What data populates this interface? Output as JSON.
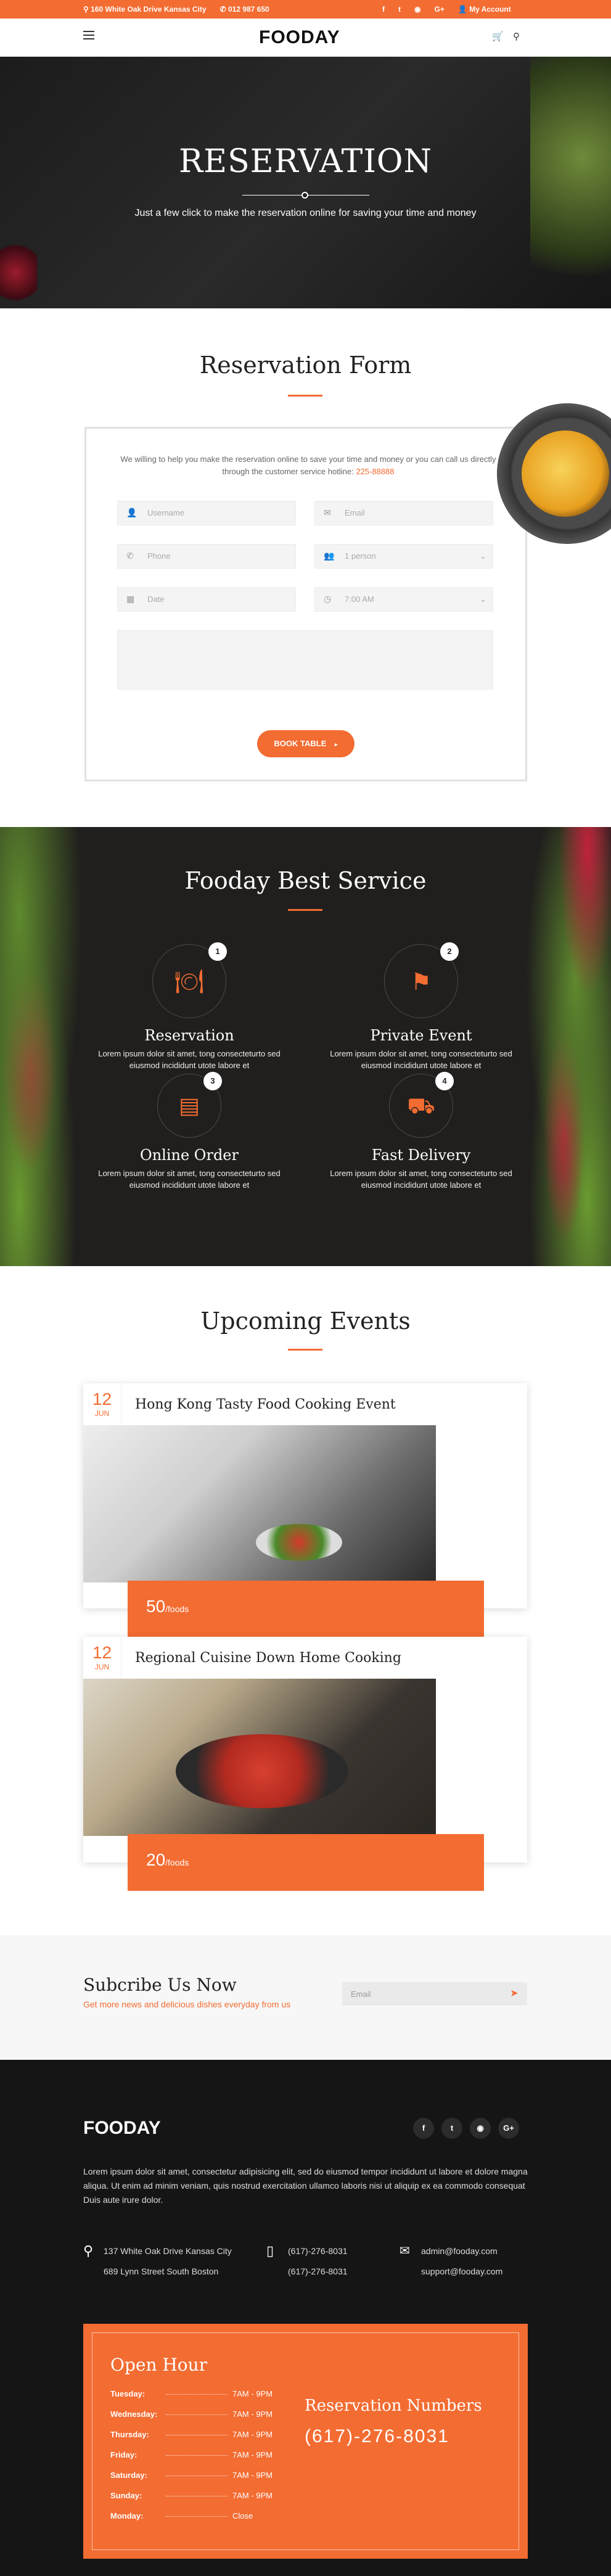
{
  "topbar": {
    "address": "160 White Oak Drive Kansas City",
    "phone": "012 987 650",
    "account": "My Account",
    "socials": [
      "f",
      "t",
      "◉",
      "G+"
    ]
  },
  "header": {
    "logo": "FOODAY"
  },
  "hero": {
    "title": "RESERVATION",
    "subtitle": "Just a few click to make the reservation online for saving your time and money"
  },
  "form": {
    "title": "Reservation Form",
    "intro": "We willing to help you make the reservation online to save your time and money or you can call us directly through the customer service hotline:",
    "hotline": "225-88888",
    "username": "Username",
    "email": "Email",
    "phone": "Phone",
    "persons": "1 person",
    "date": "Date",
    "time": "7:00 AM",
    "button": "BOOK TABLE"
  },
  "services": {
    "title": "Fooday Best Service",
    "items": [
      {
        "num": "1",
        "name": "Reservation",
        "text": "Lorem ipsum dolor sit amet, tong consecteturto sed eiusmod incididunt utote labore et"
      },
      {
        "num": "2",
        "name": "Private Event",
        "text": "Lorem ipsum dolor sit amet, tong consecteturto sed eiusmod incididunt utote labore et"
      },
      {
        "num": "3",
        "name": "Online Order",
        "text": "Lorem ipsum dolor sit amet, tong consecteturto sed eiusmod incididunt utote labore et"
      },
      {
        "num": "4",
        "name": "Fast Delivery",
        "text": "Lorem ipsum dolor sit amet, tong consecteturto sed eiusmod incididunt utote labore et"
      }
    ]
  },
  "events": {
    "title": "Upcoming Events",
    "items": [
      {
        "day": "12",
        "month": "JUN",
        "title": "Hong Kong Tasty Food Cooking Event",
        "count": "50",
        "unit": "/foods"
      },
      {
        "day": "12",
        "month": "JUN",
        "title": "Regional Cuisine Down Home Cooking",
        "count": "20",
        "unit": "/foods"
      }
    ]
  },
  "subscribe": {
    "title": "Subcribe Us Now",
    "text": "Get more news and delicious dishes everyday from us",
    "placeholder": "Email"
  },
  "footer": {
    "logo": "FOODAY",
    "about": "Lorem ipsum dolor sit amet, consectetur adipisicing elit, sed do eiusmod tempor incididunt ut labore et dolore magna aliqua. Ut enim ad minim veniam, quis nostrud exercitation ullamco laboris nisi ut aliquip ex ea commodo consequat Duis aute irure dolor.",
    "addr1": "137 White Oak Drive Kansas City",
    "addr2": "689 Lynn Street South Boston",
    "phone1": "(617)-276-8031",
    "phone2": "(617)-276-8031",
    "mail1": "admin@fooday.com",
    "mail2": "support@fooday.com",
    "socials": [
      "f",
      "t",
      "◉",
      "G+"
    ]
  },
  "hours": {
    "title": "Open Hour",
    "rows": [
      {
        "day": "Tuesday:",
        "time": "7AM - 9PM"
      },
      {
        "day": "Wednesday:",
        "time": "7AM - 9PM"
      },
      {
        "day": "Thursday:",
        "time": "7AM - 9PM"
      },
      {
        "day": "Friday:",
        "time": "7AM - 9PM"
      },
      {
        "day": "Saturday:",
        "time": "7AM - 9PM"
      },
      {
        "day": "Sunday:",
        "time": "7AM - 9PM"
      },
      {
        "day": "Monday:",
        "time": "Close"
      }
    ],
    "res_title": "Reservation Numbers",
    "res_phone": "(617)-276-8031"
  },
  "colors": {
    "accent": "#f36c32",
    "dark": "#151515"
  }
}
